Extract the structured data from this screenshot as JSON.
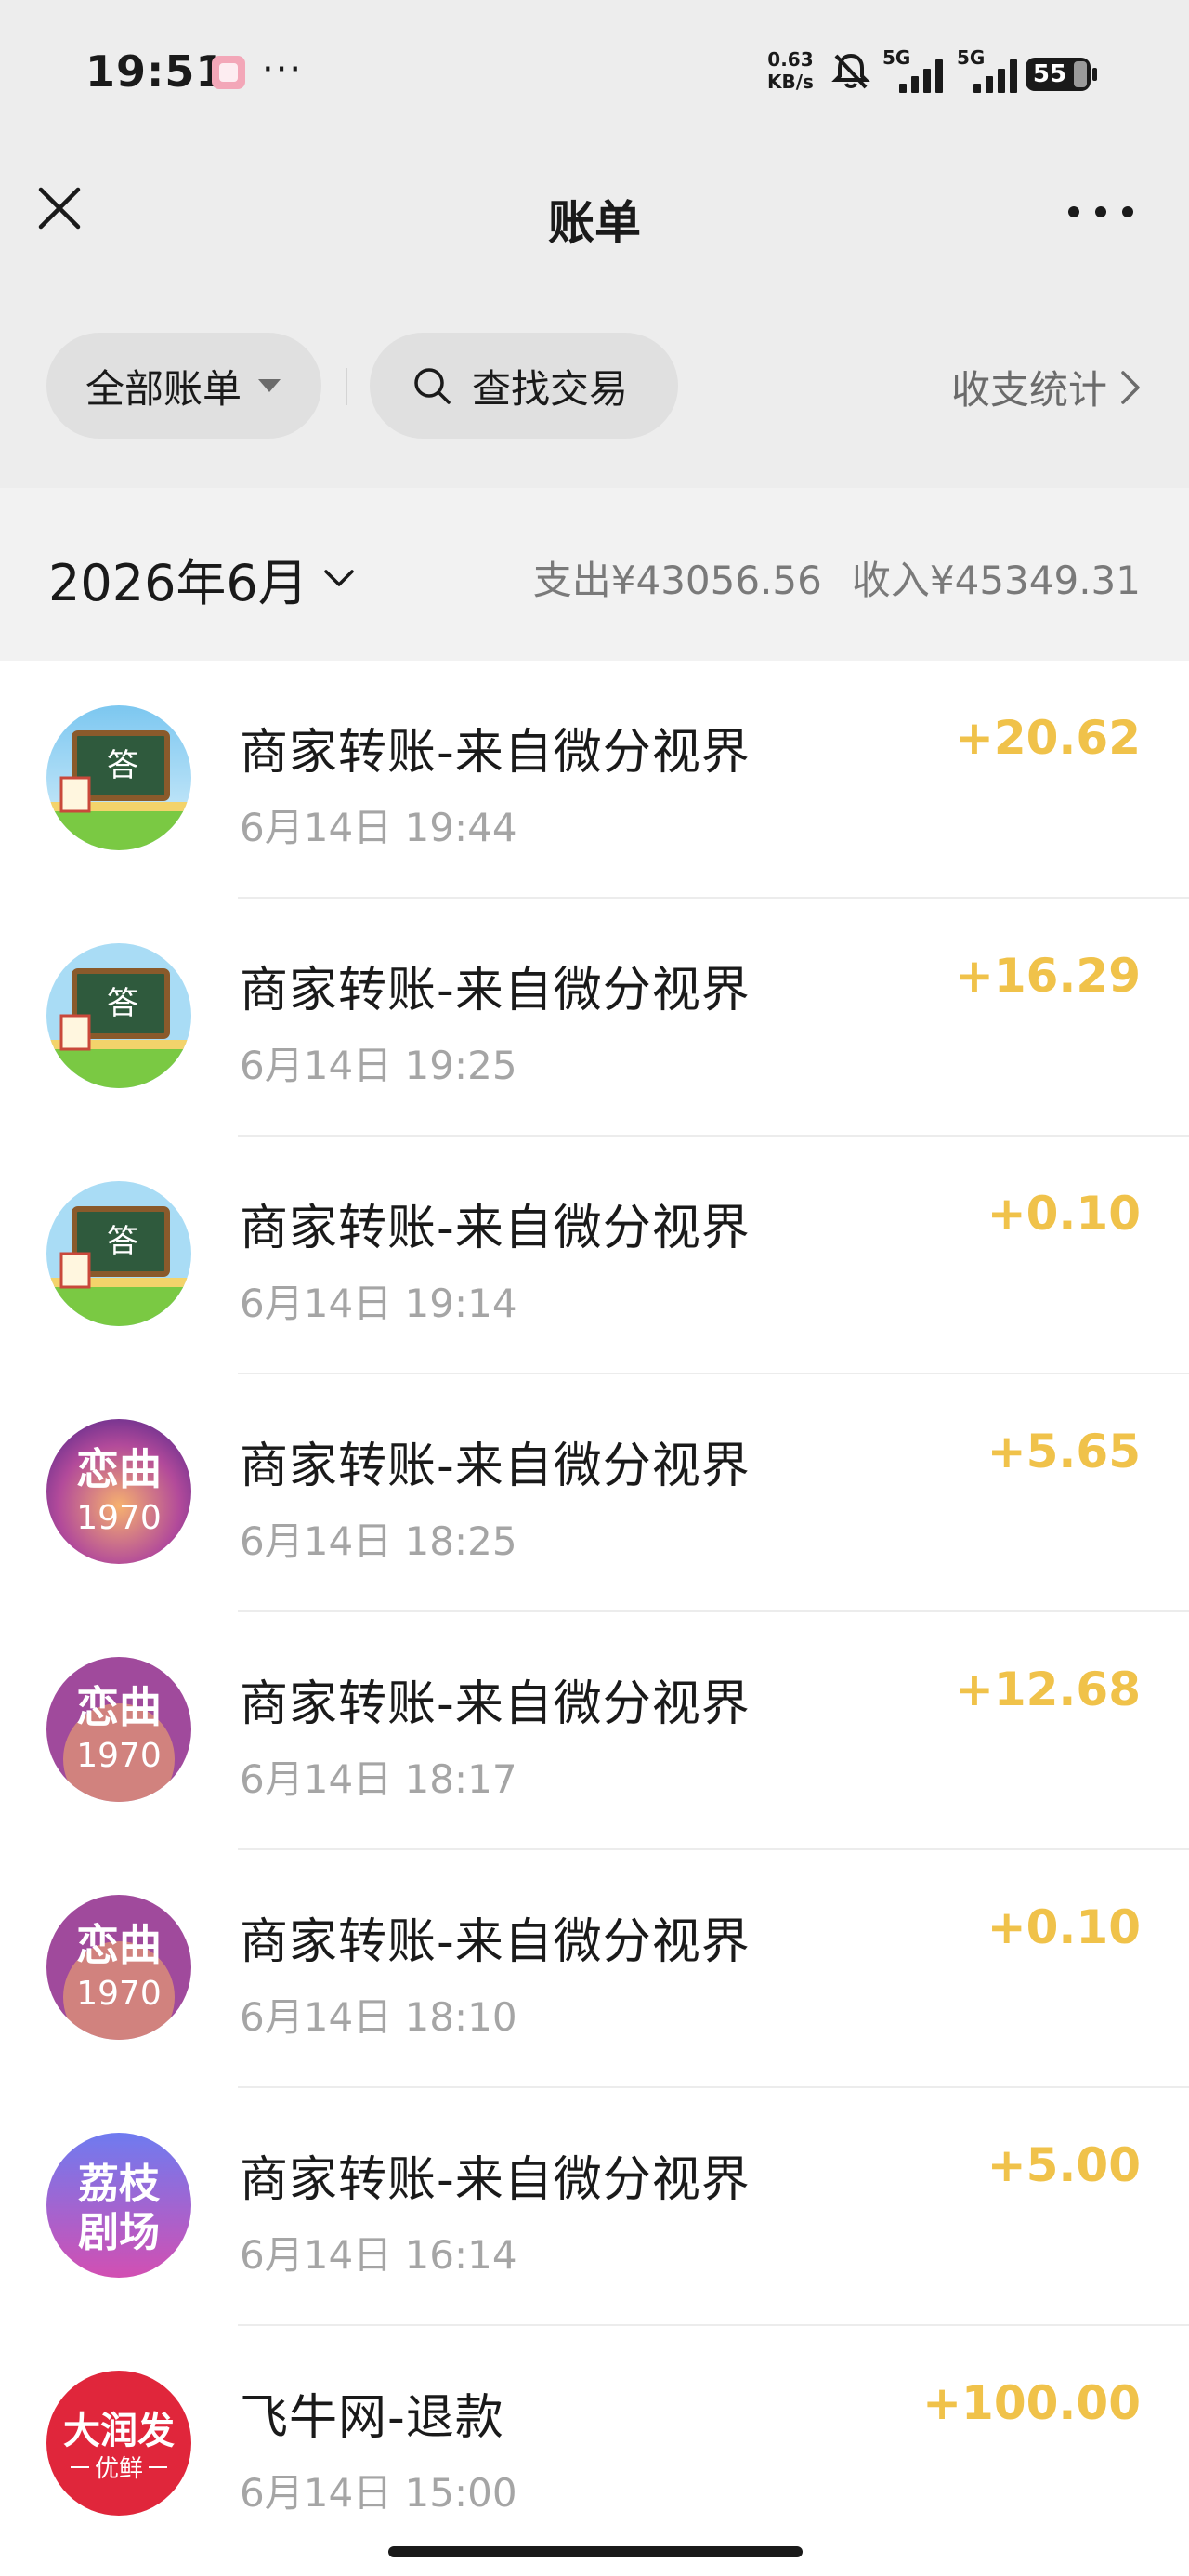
{
  "status_bar": {
    "time": "19:51",
    "more": "···",
    "speed_value": "0.63",
    "speed_unit": "KB/s",
    "signal1": "5G",
    "signal2": "5G",
    "battery": "55"
  },
  "header": {
    "title": "账单",
    "close_icon": "close-icon",
    "more_icon": "more-icon"
  },
  "filters": {
    "all_bills": "全部账单",
    "search": "查找交易",
    "stats": "收支统计"
  },
  "month": {
    "label": "2026年6月",
    "expense": "支出¥43056.56",
    "income": "收入¥45349.31"
  },
  "transactions": [
    {
      "title": "商家转账-来自微分视界",
      "time": "6月14日 19:44",
      "amount": "+20.62",
      "avatar": "答"
    },
    {
      "title": "商家转账-来自微分视界",
      "time": "6月14日 19:25",
      "amount": "+16.29",
      "avatar": "答"
    },
    {
      "title": "商家转账-来自微分视界",
      "time": "6月14日 19:14",
      "amount": "+0.10",
      "avatar": "答"
    },
    {
      "title": "商家转账-来自微分视界",
      "time": "6月14日 18:25",
      "amount": "+5.65",
      "avatar": "恋曲1970"
    },
    {
      "title": "商家转账-来自微分视界",
      "time": "6月14日 18:17",
      "amount": "+12.68",
      "avatar": "恋曲1970"
    },
    {
      "title": "商家转账-来自微分视界",
      "time": "6月14日 18:10",
      "amount": "+0.10",
      "avatar": "恋曲1970"
    },
    {
      "title": "商家转账-来自微分视界",
      "time": "6月14日 16:14",
      "amount": "+5.00",
      "avatar": "荔枝剧场"
    },
    {
      "title": "飞牛网-退款",
      "time": "6月14日 15:00",
      "amount": "+100.00",
      "avatar": "大润发优鲜"
    }
  ],
  "avatar_text": {
    "quiz": "答",
    "love_line1": "恋曲",
    "love_line2": "1970",
    "lychee_line1": "荔枝",
    "lychee_line2": "剧场",
    "rt_line1": "大润发",
    "rt_line2": "优鲜"
  },
  "colors": {
    "amount": "#f0c24a",
    "header_bg": "#ededed",
    "month_bg": "#f2f2f2"
  }
}
